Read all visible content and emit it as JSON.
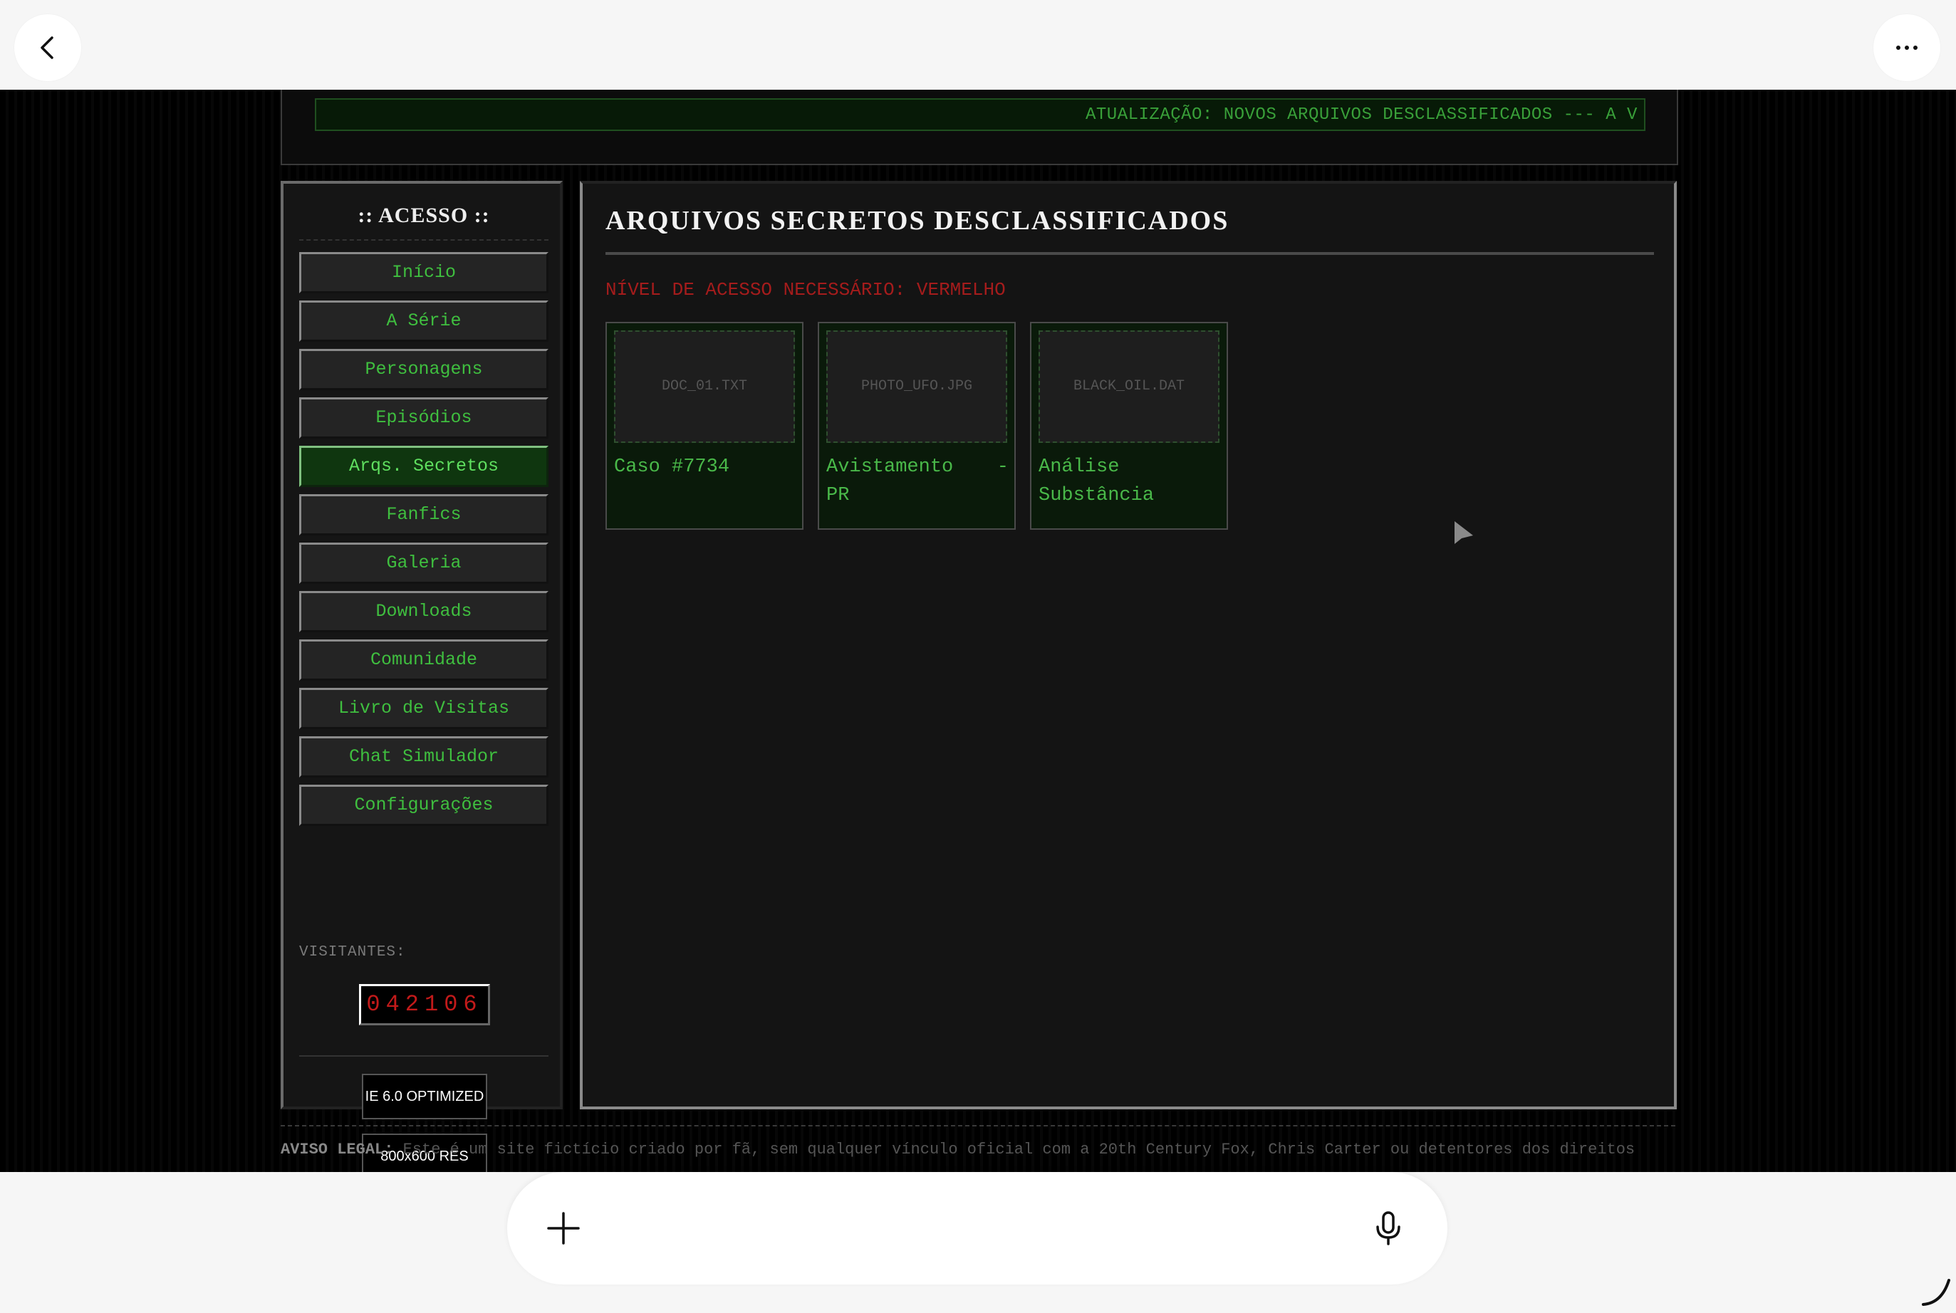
{
  "ticker": {
    "text": "ATUALIZAÇÃO: NOVOS ARQUIVOS DESCLASSIFICADOS --- A V"
  },
  "sidebar": {
    "title": ":: ACESSO ::",
    "items": [
      {
        "label": "Início"
      },
      {
        "label": "A Série"
      },
      {
        "label": "Personagens"
      },
      {
        "label": "Episódios"
      },
      {
        "label": "Arqs. Secretos",
        "active": true
      },
      {
        "label": "Fanfics"
      },
      {
        "label": "Galeria"
      },
      {
        "label": "Downloads"
      },
      {
        "label": "Comunidade"
      },
      {
        "label": "Livro de Visitas"
      },
      {
        "label": "Chat Simulador"
      },
      {
        "label": "Configurações"
      }
    ],
    "visitors_label": "VISITANTES:",
    "visitor_count": "042106",
    "badges": [
      "IE 6.0 OPTIMIZED",
      "800x600 RES"
    ]
  },
  "main": {
    "title": "ARQUIVOS SECRETOS DESCLASSIFICADOS",
    "access_level": "NÍVEL DE ACESSO NECESSÁRIO: VERMELHO",
    "files": [
      {
        "filename": "DOC_01.TXT",
        "label": "Caso #7734"
      },
      {
        "filename": "PHOTO_UFO.JPG",
        "label": "Avistamento - PR"
      },
      {
        "filename": "BLACK_OIL.DAT",
        "label": "Análise Substância"
      }
    ]
  },
  "footer": {
    "legal_label": "AVISO LEGAL:",
    "legal_text": "Este é um site fictício criado por fã, sem qualquer vínculo oficial com a 20th Century Fox, Chris Carter ou detentores dos direitos"
  },
  "colors": {
    "accent_green": "#3fbf3f",
    "alert_red": "#a51c1c",
    "counter_red": "#c21a1a"
  },
  "icons": {
    "back": "chevron-left-icon",
    "more": "ellipsis-icon",
    "add": "plus-icon",
    "voice": "microphone-icon",
    "cursor": "cursor-icon"
  }
}
